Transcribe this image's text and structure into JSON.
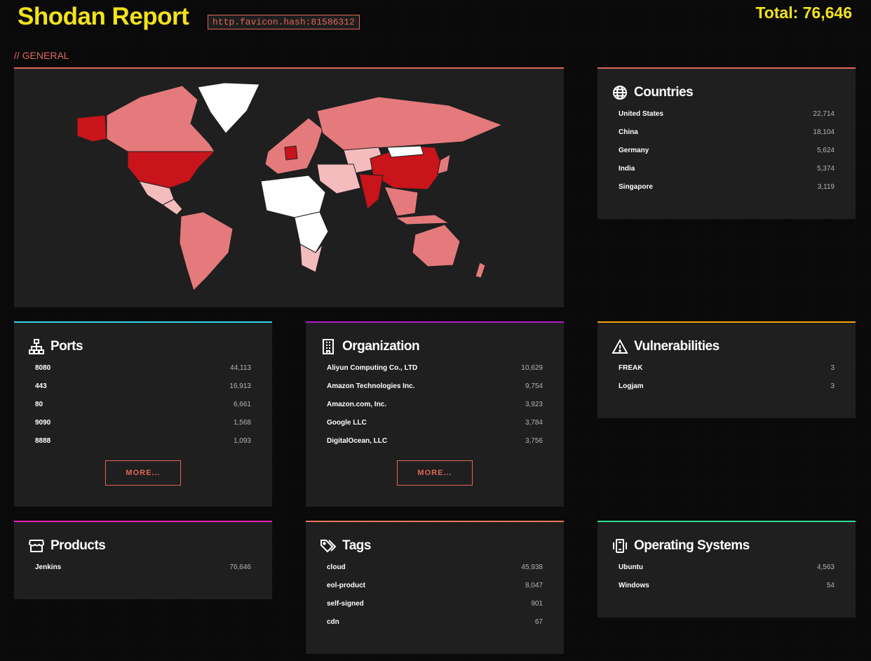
{
  "header": {
    "title": "Shodan Report",
    "query": "http.favicon.hash:81586312",
    "total": "Total: 76,646"
  },
  "section_label": "// GENERAL",
  "countries": {
    "title": "Countries",
    "icon": "globe-icon",
    "rows": [
      {
        "k": "United States",
        "v": "22,714"
      },
      {
        "k": "China",
        "v": "18,104"
      },
      {
        "k": "Germany",
        "v": "5,624"
      },
      {
        "k": "India",
        "v": "5,374"
      },
      {
        "k": "Singapore",
        "v": "3,119"
      }
    ]
  },
  "ports": {
    "title": "Ports",
    "icon": "network-icon",
    "rows": [
      {
        "k": "8080",
        "v": "44,113"
      },
      {
        "k": "443",
        "v": "16,913"
      },
      {
        "k": "80",
        "v": "6,661"
      },
      {
        "k": "9090",
        "v": "1,568"
      },
      {
        "k": "8888",
        "v": "1,093"
      }
    ],
    "more": "MORE..."
  },
  "organization": {
    "title": "Organization",
    "icon": "building-icon",
    "rows": [
      {
        "k": "Aliyun Computing Co., LTD",
        "v": "10,629"
      },
      {
        "k": "Amazon Technologies Inc.",
        "v": "9,754"
      },
      {
        "k": "Amazon.com, Inc.",
        "v": "3,923"
      },
      {
        "k": "Google LLC",
        "v": "3,784"
      },
      {
        "k": "DigitalOcean, LLC",
        "v": "3,756"
      }
    ],
    "more": "MORE..."
  },
  "vulnerabilities": {
    "title": "Vulnerabilities",
    "icon": "warning-icon",
    "rows": [
      {
        "k": "FREAK",
        "v": "3"
      },
      {
        "k": "Logjam",
        "v": "3"
      }
    ]
  },
  "products": {
    "title": "Products",
    "icon": "store-icon",
    "rows": [
      {
        "k": "Jenkins",
        "v": "76,646"
      }
    ]
  },
  "tags": {
    "title": "Tags",
    "icon": "tags-icon",
    "rows": [
      {
        "k": "cloud",
        "v": "45,938"
      },
      {
        "k": "eol-product",
        "v": "8,047"
      },
      {
        "k": "self-signed",
        "v": "901"
      },
      {
        "k": "cdn",
        "v": "67"
      }
    ]
  },
  "operating_systems": {
    "title": "Operating Systems",
    "icon": "chip-icon",
    "rows": [
      {
        "k": "Ubuntu",
        "v": "4,563"
      },
      {
        "k": "Windows",
        "v": "54"
      }
    ]
  },
  "colors": {
    "title_yellow": "#f3e21a",
    "accent_red": "#e0675a",
    "card_bg": "#1f1f1f",
    "ports_accent": "#2ad6e6",
    "org_accent": "#b31cc9",
    "vulns_accent": "#f1a20c",
    "products_accent": "#e61fb8",
    "tags_accent": "#e8775e",
    "os_accent": "#2ede93",
    "map_high": "#c8141a",
    "map_mid": "#e57a7c",
    "map_low": "#f5bcbd",
    "map_none": "#ffffff"
  }
}
